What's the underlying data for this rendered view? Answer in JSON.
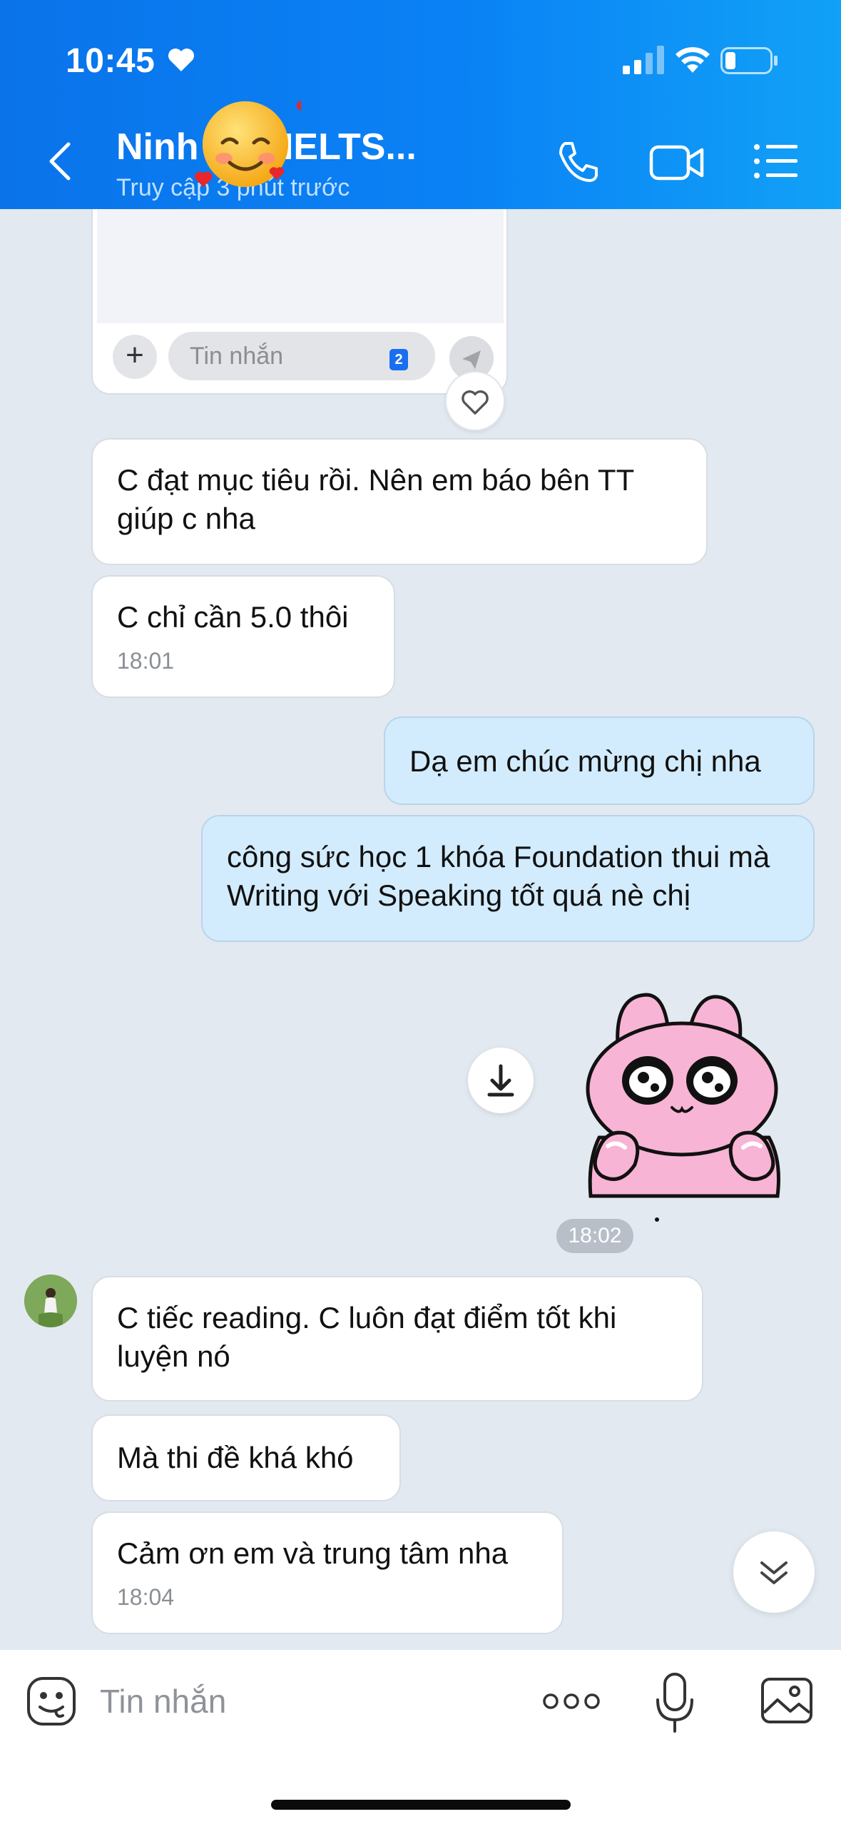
{
  "status_bar": {
    "time": "10:45"
  },
  "header": {
    "title": "Ninh - McIELTS...",
    "subtitle": "Truy cập 3 phút trước",
    "icons": [
      "back-icon",
      "phone-icon",
      "video-call-icon",
      "menu-list-icon"
    ]
  },
  "preview": {
    "input_placeholder": "Tin nhắn",
    "badge": "2"
  },
  "messages": [
    {
      "side": "in",
      "text": "C đạt mục tiêu rồi. Nên em báo bên TT giúp c nha"
    },
    {
      "side": "in",
      "text": "C chỉ cần 5.0 thôi",
      "time": "18:01"
    },
    {
      "side": "out",
      "text": "Dạ em chúc mừng chị nha"
    },
    {
      "side": "out",
      "text": "công sức học 1 khóa Foundation thui mà Writing với Speaking tốt quá nè chị"
    },
    {
      "side": "out",
      "type": "sticker",
      "time": "18:02"
    },
    {
      "side": "in",
      "text": "C tiếc reading. C luôn đạt điểm tốt khi luyện nó"
    },
    {
      "side": "in",
      "text": "Mà thi đề khá khó"
    },
    {
      "side": "in",
      "text": "Cảm ơn em và trung tâm nha",
      "time": "18:04"
    }
  ],
  "input_bar": {
    "placeholder": "Tin nhắn"
  },
  "colors": {
    "header_start": "#0a73ea",
    "header_end": "#11a1f7",
    "chat_bg": "#e2e9f1",
    "outgoing_bubble": "#d3ecfd",
    "incoming_bubble": "#ffffff"
  }
}
